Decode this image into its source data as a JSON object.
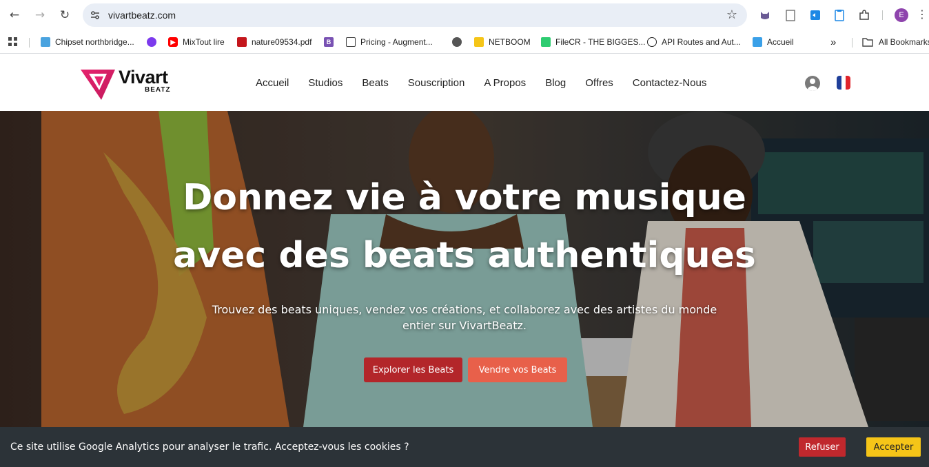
{
  "browser": {
    "url": "vivartbeatz.com",
    "profile_initial": "E",
    "icons": {
      "back": "arrow-left-icon",
      "forward": "arrow-right-icon",
      "reload": "reload-icon",
      "site_settings": "tune-icon",
      "bookmark_star": "star-icon"
    }
  },
  "bookmarks": {
    "items": [
      {
        "label": "Chipset northbridge...",
        "icon": "chipset-icon",
        "color": "#4aa3df"
      },
      {
        "label": "",
        "icon": "purple-swirl-icon",
        "color": "#7c3aed"
      },
      {
        "label": "MixTout lire",
        "icon": "youtube-icon",
        "color": "#ff0000"
      },
      {
        "label": "nature09534.pdf",
        "icon": "pdf-icon",
        "color": "#c4161c"
      },
      {
        "label": "",
        "icon": "bootstrap-icon",
        "color": "#7952b3"
      },
      {
        "label": "Pricing - Augment...",
        "icon": "augment-icon",
        "color": "#444444"
      },
      {
        "label": "",
        "icon": "globe-icon",
        "color": "#555555"
      },
      {
        "label": "NETBOOM",
        "icon": "netboom-icon",
        "color": "#f5c518"
      },
      {
        "label": "FileCR - THE BIGGES...",
        "icon": "filecr-icon",
        "color": "#2ecc71"
      },
      {
        "label": "API Routes and Aut...",
        "icon": "no-icon",
        "color": "#222222"
      },
      {
        "label": "Accueil",
        "icon": "site-icon",
        "color": "#3aa0e8"
      }
    ],
    "more": "»",
    "all_bookmarks": "All Bookmarks"
  },
  "site": {
    "logo_text": "Vivart",
    "logo_sub": "BEATZ",
    "nav": [
      "Accueil",
      "Studios",
      "Beats",
      "Souscription",
      "A Propos",
      "Blog",
      "Offres",
      "Contactez-Nous"
    ],
    "language_flag": "fr"
  },
  "hero": {
    "title_line1": "Donnez vie à votre musique",
    "title_line2": "avec des beats authentiques",
    "subtitle": "Trouvez des beats uniques, vendez vos créations, et collaborez avec des artistes du monde entier sur VivartBeatz.",
    "cta_primary": "Explorer les Beats",
    "cta_secondary": "Vendre vos Beats"
  },
  "cookie": {
    "text": "Ce site utilise Google Analytics pour analyser le trafic. Acceptez-vous les cookies ?",
    "refuse": "Refuser",
    "accept": "Accepter"
  },
  "colors": {
    "brand_red": "#b3262a",
    "brand_coral": "#e8604a",
    "cookie_bg": "#2c3338",
    "accept_yellow": "#f5c518",
    "logo_gradient_start": "#e6246e",
    "logo_gradient_end": "#c2185b"
  }
}
